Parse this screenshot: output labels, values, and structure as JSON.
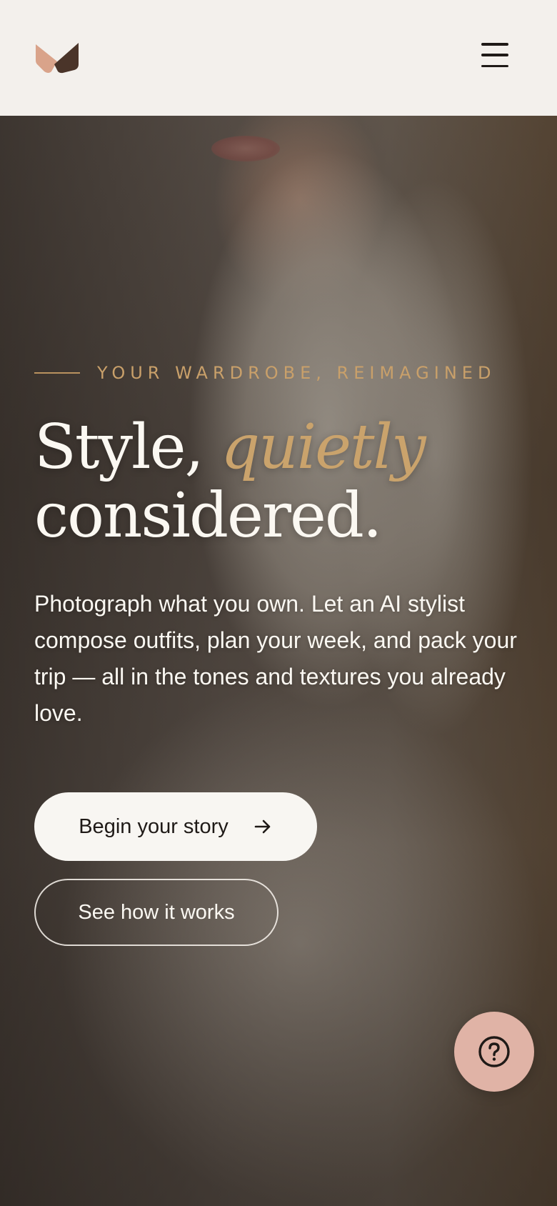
{
  "header": {
    "logo_icon": "brand-logo-icon",
    "menu_icon": "hamburger-menu-icon"
  },
  "hero": {
    "eyebrow": "YOUR WARDROBE, REIMAGINED",
    "headline_part1": "Style,",
    "headline_accent": "quietly",
    "headline_part2": "considered.",
    "lede": "Photograph what you own. Let an AI stylist compose outfits, plan your week, and pack your trip — all in the tones and textures you already love.",
    "primary_cta": "Begin your story",
    "primary_cta_icon": "arrow-right-icon",
    "secondary_cta": "See how it works"
  },
  "help": {
    "icon": "question-circle-icon"
  },
  "colors": {
    "header_bg": "#f3f0ec",
    "accent_gold": "#caa36c",
    "primary_button_bg": "#f8f6f2",
    "help_fab_bg": "#e0b3a6",
    "logo_peach": "#d9a38a",
    "logo_brown": "#4a3429"
  }
}
